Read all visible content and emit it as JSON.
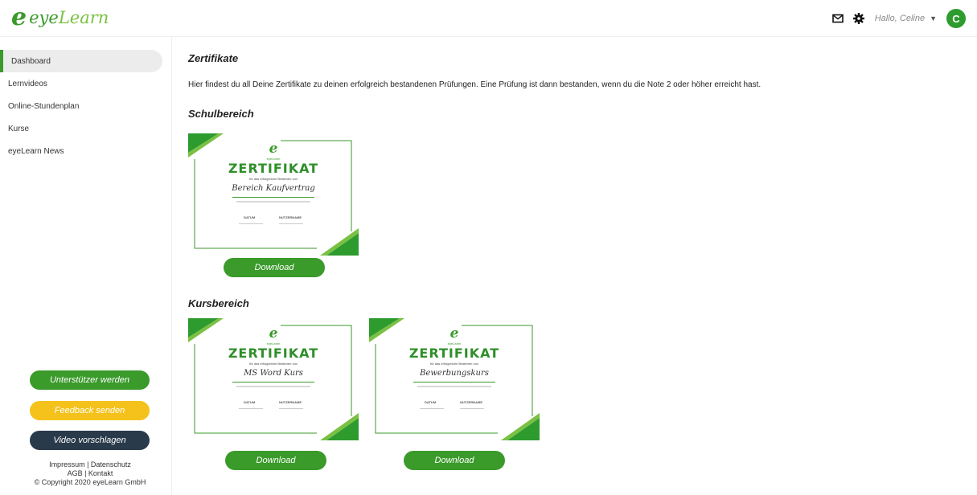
{
  "app": {
    "logo_e": "e",
    "logo_eye": "eye",
    "logo_learn": "Learn"
  },
  "header": {
    "greeting": "Hallo, Celine",
    "avatar_initial": "C",
    "icons": [
      "mail-icon",
      "gear-icon",
      "chevron-down-icon"
    ]
  },
  "sidebar": {
    "items": [
      {
        "label": "Dashboard",
        "active": true
      },
      {
        "label": "Lernvideos",
        "active": false
      },
      {
        "label": "Online-Stundenplan",
        "active": false
      },
      {
        "label": "Kurse",
        "active": false
      },
      {
        "label": "eyeLearn News",
        "active": false
      }
    ],
    "support_button": "Unterstützer werden",
    "feedback_button": "Feedback senden",
    "video_button": "Video vorschlagen",
    "footer": {
      "line1": "Impressum | Datenschutz",
      "line2": "AGB | Kontakt",
      "line3": "© Copyright 2020 eyeLearn GmbH"
    }
  },
  "main": {
    "title": "Zertifikate",
    "description": "Hier findest du all Deine Zertifikate zu deinen erfolgreich bestandenen Prüfungen. Eine Prüfung ist dann bestanden, wenn du die Note 2 oder höher erreicht hast.",
    "sections": [
      {
        "title": "Schulbereich",
        "certificates": [
          {
            "name": "Bereich Kaufvertrag",
            "download_label": "Download"
          }
        ]
      },
      {
        "title": "Kursbereich",
        "certificates": [
          {
            "name": "MS Word Kurs",
            "download_label": "Download"
          },
          {
            "name": "Bewerbungskurs",
            "download_label": "Download"
          }
        ]
      }
    ],
    "cert_template": {
      "logo": "e",
      "logo_small": "eyeLearn",
      "title": "ZERTIFIKAT",
      "subtitle": "für das erfolgreiche Bestehen von",
      "date_label": "DATUM",
      "user_label": "NUTZERNAME"
    }
  },
  "colors": {
    "brand_green": "#3a9a2a",
    "light_green": "#7ac143",
    "feedback_yellow": "#f5c21b",
    "video_navy": "#293a4a"
  }
}
